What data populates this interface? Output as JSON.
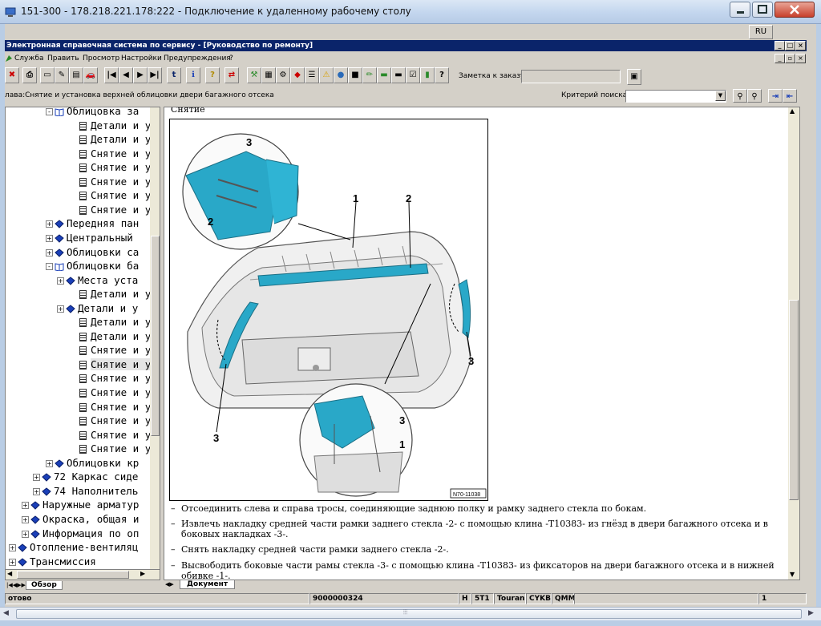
{
  "rdp": {
    "title": "151-300 - 178.218.221.178:222 - Подключение к удаленному рабочему столу",
    "lang": "RU"
  },
  "app": {
    "title": "Электронная справочная система по сервису - [Руководство по ремонту]",
    "menu": [
      "Служба",
      "Править",
      "Просмотр",
      "Настройки",
      "Предупреждения",
      "?"
    ],
    "order_note_label": "Заметка к заказу:",
    "breadcrumb": "лава:Снятие и установка верхней облицовки двери багажного отсека",
    "search_label": "Критерий поиска:"
  },
  "tree": {
    "items": [
      {
        "text": "Облицовка за",
        "type": "openbook",
        "indent": 64,
        "exp": "-"
      },
      {
        "text": "Детали и у",
        "type": "page",
        "indent": 92
      },
      {
        "text": "Детали и у",
        "type": "page",
        "indent": 92
      },
      {
        "text": "Снятие и у",
        "type": "page",
        "indent": 92
      },
      {
        "text": "Снятие и у",
        "type": "page",
        "indent": 92
      },
      {
        "text": "Снятие и у",
        "type": "page",
        "indent": 92
      },
      {
        "text": "Снятие и у",
        "type": "page",
        "indent": 92
      },
      {
        "text": "Снятие и у",
        "type": "page",
        "indent": 92
      },
      {
        "text": "Передняя пан",
        "type": "book",
        "indent": 64,
        "exp": "+"
      },
      {
        "text": "Центральный",
        "type": "book",
        "indent": 64,
        "exp": "+"
      },
      {
        "text": "Облицовки са",
        "type": "book",
        "indent": 64,
        "exp": "+"
      },
      {
        "text": "Облицовки ба",
        "type": "openbook",
        "indent": 64,
        "exp": "-"
      },
      {
        "text": "Места уста",
        "type": "book",
        "indent": 78,
        "exp": "+"
      },
      {
        "text": "Детали и у",
        "type": "page",
        "indent": 92
      },
      {
        "text": "Детали и у",
        "type": "book",
        "indent": 78,
        "exp": "+"
      },
      {
        "text": "Детали и у",
        "type": "page",
        "indent": 92
      },
      {
        "text": "Детали и у",
        "type": "page",
        "indent": 92
      },
      {
        "text": "Снятие и у",
        "type": "page",
        "indent": 92
      },
      {
        "text": "Снятие и у",
        "type": "page",
        "indent": 92,
        "selected": true
      },
      {
        "text": "Снятие и у",
        "type": "page",
        "indent": 92
      },
      {
        "text": "Снятие и у",
        "type": "page",
        "indent": 92
      },
      {
        "text": "Снятие и у",
        "type": "page",
        "indent": 92
      },
      {
        "text": "Снятие и у",
        "type": "page",
        "indent": 92
      },
      {
        "text": "Снятие и у",
        "type": "page",
        "indent": 92
      },
      {
        "text": "Снятие и у",
        "type": "page",
        "indent": 92
      },
      {
        "text": "Облицовки кр",
        "type": "book",
        "indent": 64,
        "exp": "+"
      },
      {
        "text": "72 Каркас сиде",
        "type": "book",
        "indent": 48,
        "exp": "+"
      },
      {
        "text": "74 Наполнитель",
        "type": "book",
        "indent": 48,
        "exp": "+"
      },
      {
        "text": "Наружные арматур",
        "type": "book",
        "indent": 34,
        "exp": "+"
      },
      {
        "text": "Окраска, общая и",
        "type": "book",
        "indent": 34,
        "exp": "+"
      },
      {
        "text": "Информация по оп",
        "type": "book",
        "indent": 34,
        "exp": "+"
      },
      {
        "text": "Отопление-вентиляц",
        "type": "book",
        "indent": 18,
        "exp": "+"
      },
      {
        "text": "Трансмиссия",
        "type": "book",
        "indent": 18,
        "exp": "+"
      }
    ],
    "tab": "Обзор"
  },
  "document": {
    "heading": "Снятие",
    "tab": "Документ",
    "figure_id": "N70-11038",
    "callouts": [
      "1",
      "2",
      "3",
      "3",
      "3",
      "2",
      "3",
      "1"
    ],
    "steps": [
      "Отсоединить слева и справа тросы, соединяющие заднюю полку и рамку заднего стекла по бокам.",
      "Извлечь накладку средней части рамки заднего стекла -2- с помощью клина -T10383- из гнёзд в двери багажного отсека и в боковых накладках -3-.",
      "Снять накладку средней части рамки заднего стекла -2-.",
      "Высвободить боковые части рамы стекла -3- с помощью клина -T10383- из фиксаторов на двери багажного отсека и в нижней обивке -1-."
    ]
  },
  "status": {
    "ready": "отово",
    "code": "9000000324",
    "h": "H",
    "st1": "5T1",
    "model": "Touran",
    "cykb": "CYKB",
    "qmm": "QMM",
    "page": "1"
  },
  "colors": {
    "highlight": "#29a8c8",
    "title_bg": "#0a246a",
    "book": "#1a3fb8"
  }
}
